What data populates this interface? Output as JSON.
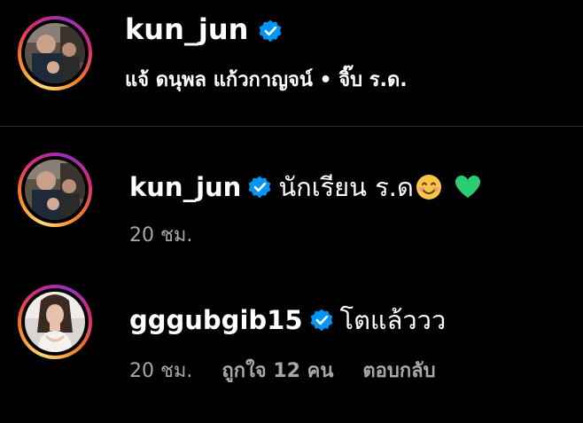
{
  "header": {
    "username": "kun_jun",
    "subtitle": "แจ้ ดนุพล แก้วกาญจน์ • จิ๊บ ร.ด."
  },
  "comments": [
    {
      "username": "kun_jun",
      "text": "นักเรียน ร.ด",
      "time": "20 ชม.",
      "emojis": [
        "smiling-face-emoji",
        "green-heart-emoji"
      ]
    },
    {
      "username": "gggubgib15",
      "text": "โตแล้ววว",
      "time": "20 ชม.",
      "likes": "ถูกใจ 12 คน",
      "reply": "ตอบกลับ"
    }
  ],
  "colors": {
    "background": "#000000",
    "text": "#ffffff",
    "muted": "#a8a8a8",
    "verified": "#0095f6",
    "divider": "#2e2e2e"
  }
}
